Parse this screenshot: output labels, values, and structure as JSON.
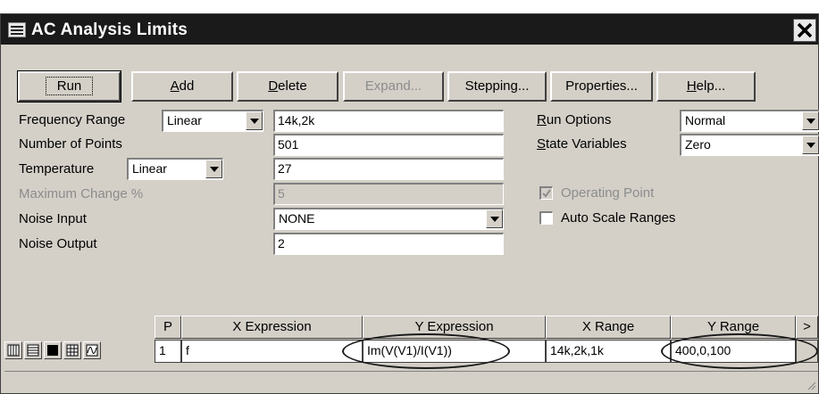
{
  "window": {
    "title": "AC Analysis Limits"
  },
  "toolbar": {
    "run": "Run",
    "add_pre": "",
    "add_u": "A",
    "add_post": "dd",
    "delete_u": "D",
    "delete_post": "elete",
    "expand": "Expand...",
    "stepping": "Stepping...",
    "properties": "Properties...",
    "help_u": "H",
    "help_post": "elp..."
  },
  "fields": {
    "frequency_range": {
      "label": "Frequency Range",
      "mode": "Linear",
      "value": "14k,2k"
    },
    "number_of_points": {
      "label": "Number of Points",
      "value": "501"
    },
    "temperature": {
      "label": "Temperature",
      "mode": "Linear",
      "value": "27"
    },
    "maximum_change": {
      "label": "Maximum Change %",
      "value": "5"
    },
    "noise_input": {
      "label": "Noise Input",
      "value": "NONE"
    },
    "noise_output": {
      "label": "Noise Output",
      "value": "2"
    }
  },
  "options": {
    "run_options": {
      "label_u": "R",
      "label_post": "un Options",
      "value": "Normal"
    },
    "state_variables": {
      "label_u": "S",
      "label_post": "tate Variables",
      "value": "Zero"
    },
    "operating_point": {
      "label": "Operating Point",
      "checked": true,
      "enabled": false
    },
    "auto_scale": {
      "label": "Auto Scale Ranges",
      "checked": false
    }
  },
  "grid": {
    "headers": {
      "p": "P",
      "x_expr": "X Expression",
      "y_expr": "Y Expression",
      "x_range": "X Range",
      "y_range": "Y Range",
      "more": ">"
    },
    "row": {
      "p": "1",
      "x_expr": "f",
      "y_expr": "Im(V(V1)/I(V1))",
      "x_range": "14k,2k,1k",
      "y_range": "400,0,100"
    }
  },
  "colors": {
    "title_bar": "#1a1a1a",
    "face": "#d4d0c8",
    "field": "#ffffff",
    "disabled_text": "#8c8c8c"
  }
}
